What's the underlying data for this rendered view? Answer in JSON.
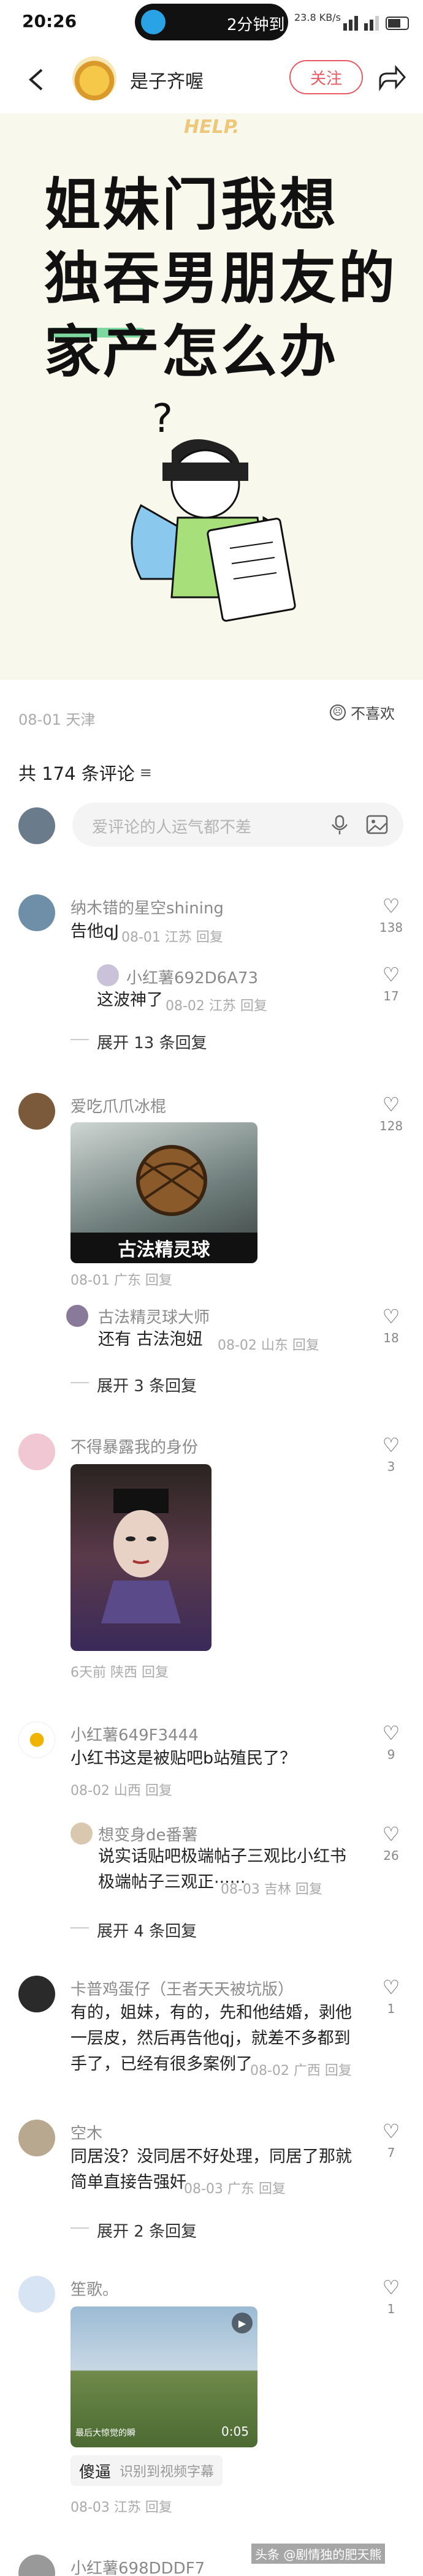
{
  "status": {
    "time": "20:26",
    "pill_text": "2分钟到",
    "right_info": "23.8 KB/s"
  },
  "header": {
    "author": "是子齐喔",
    "follow": "关注"
  },
  "cover": {
    "help": "HELP.",
    "line1": "姐妹门我想",
    "line2": "独吞男朋友的",
    "line3": "家产怎么办"
  },
  "meta": {
    "date_loc": "08-01 天津",
    "dislike": "不喜欢"
  },
  "comments_header": {
    "count_text": "共 174 条评论",
    "input_placeholder": "爱评论的人运气都不差"
  },
  "comments": [
    {
      "name": "纳木错的星空shining",
      "text": "告他qJ",
      "meta": "08-01 江苏  回复",
      "likes": "138",
      "reply": {
        "name": "小红薯692D6A73",
        "text": "这波神了",
        "meta": "08-02 江苏  回复",
        "likes": "17"
      },
      "expand": "展开 13 条回复"
    },
    {
      "name": "爱吃爪爪冰棍",
      "img_caption": "古法精灵球",
      "meta": "08-01 广东  回复",
      "likes": "128",
      "reply": {
        "name": "古法精灵球大师",
        "text": "还有 古法泡妞",
        "meta": "08-02 山东  回复",
        "likes": "18"
      },
      "expand": "展开 3 条回复"
    },
    {
      "name": "不得暴露我的身份",
      "meta": "6天前 陕西  回复",
      "likes": "3"
    },
    {
      "name": "小红薯649F3444",
      "text": "小红书这是被贴吧b站殖民了？",
      "meta": "08-02 山西  回复",
      "likes": "9",
      "reply": {
        "name": "想变身de番薯",
        "text": "说实话贴吧极端帖子三观比小红书极端帖子三观正······",
        "meta": "08-03 吉林  回复",
        "likes": "26"
      },
      "expand": "展开 4 条回复"
    },
    {
      "name": "卡普鸡蛋仔（王者天天被坑版）",
      "text": "有的，姐妹，有的，先和他结婚，剥他一层皮，然后再告他qj，就差不多都到手了，已经有很多案例了",
      "meta": "08-02 广西  回复",
      "likes": "1"
    },
    {
      "name": "空木",
      "text": "同居没？没同居不好处理，同居了那就简单直接告强奸",
      "meta": "08-03 广东  回复",
      "likes": "7",
      "expand": "展开 2 条回复"
    },
    {
      "name": "笙歌。",
      "video_title": "最后大惊觉的瞬",
      "video_duration": "0:05",
      "video_text": "傻逼",
      "video_sub": "识别到视频字幕",
      "meta": "08-03 江苏  回复",
      "likes": "1"
    },
    {
      "name": "小红薯698DDDF7"
    }
  ],
  "watermark": "头条 @剧情独的肥天熊",
  "colors": {
    "accent": "#e95a63",
    "link": "#4a6fa5",
    "cover_bg": "#f8f8ec"
  }
}
